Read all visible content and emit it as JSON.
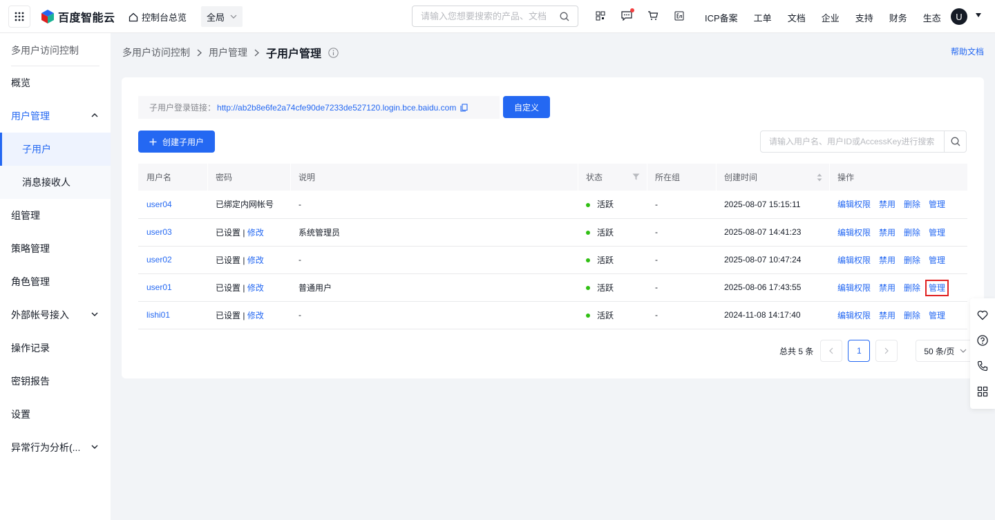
{
  "topbar": {
    "logo_text": "百度智能云",
    "home_label": "控制台总览",
    "region_label": "全局",
    "search_placeholder": "请输入您想要搜索的产品、文档",
    "links": [
      "ICP备案",
      "工单",
      "文档",
      "企业",
      "支持",
      "财务",
      "生态"
    ],
    "avatar_letter": "U"
  },
  "sidebar": {
    "title": "多用户访问控制",
    "items": [
      {
        "label": "概览"
      },
      {
        "label": "用户管理"
      },
      {
        "label": "子用户"
      },
      {
        "label": "消息接收人"
      },
      {
        "label": "组管理"
      },
      {
        "label": "策略管理"
      },
      {
        "label": "角色管理"
      },
      {
        "label": "外部帐号接入"
      },
      {
        "label": "操作记录"
      },
      {
        "label": "密钥报告"
      },
      {
        "label": "设置"
      },
      {
        "label": "异常行为分析(..."
      }
    ]
  },
  "breadcrumb": {
    "items": [
      "多用户访问控制",
      "用户管理",
      "子用户管理"
    ],
    "help": "帮助文档"
  },
  "toolbar": {
    "login_label": "子用户登录链接：",
    "login_url": "http://ab2b8e6fe2a74cfe90de7233de527120.login.bce.baidu.com",
    "custom_button": "自定义",
    "create_button": "创建子用户",
    "search_placeholder": "请输入用户名、用户ID或AccessKey进行搜索"
  },
  "table": {
    "headers": [
      "用户名",
      "密码",
      "说明",
      "状态",
      "所在组",
      "创建时间",
      "操作"
    ],
    "rows": [
      {
        "name": "user04",
        "pwd": "已绑定内网帐号",
        "pwd_sep": "",
        "pwd_edit": "",
        "desc": "-",
        "status": "活跃",
        "group": "-",
        "created": "2025-08-07 15:15:11"
      },
      {
        "name": "user03",
        "pwd": "已设置",
        "pwd_sep": " | ",
        "pwd_edit": "修改",
        "desc": "系统管理员",
        "status": "活跃",
        "group": "-",
        "created": "2025-08-07 14:41:23"
      },
      {
        "name": "user02",
        "pwd": "已设置",
        "pwd_sep": " | ",
        "pwd_edit": "修改",
        "desc": "-",
        "status": "活跃",
        "group": "-",
        "created": "2025-08-07 10:47:24"
      },
      {
        "name": "user01",
        "pwd": "已设置",
        "pwd_sep": " | ",
        "pwd_edit": "修改",
        "desc": "普通用户",
        "status": "活跃",
        "group": "-",
        "created": "2025-08-06 17:43:55"
      },
      {
        "name": "lishi01",
        "pwd": "已设置",
        "pwd_sep": " | ",
        "pwd_edit": "修改",
        "desc": "-",
        "status": "活跃",
        "group": "-",
        "created": "2024-11-08 14:17:40"
      }
    ],
    "ops": [
      "编辑权限",
      "禁用",
      "删除",
      "管理"
    ]
  },
  "pagination": {
    "total": "总共 5 条",
    "current_page": "1",
    "page_size": "50 条/页"
  },
  "colors": {
    "primary": "#2468f2",
    "active_status": "#30bf13",
    "highlight": "#e02020"
  }
}
